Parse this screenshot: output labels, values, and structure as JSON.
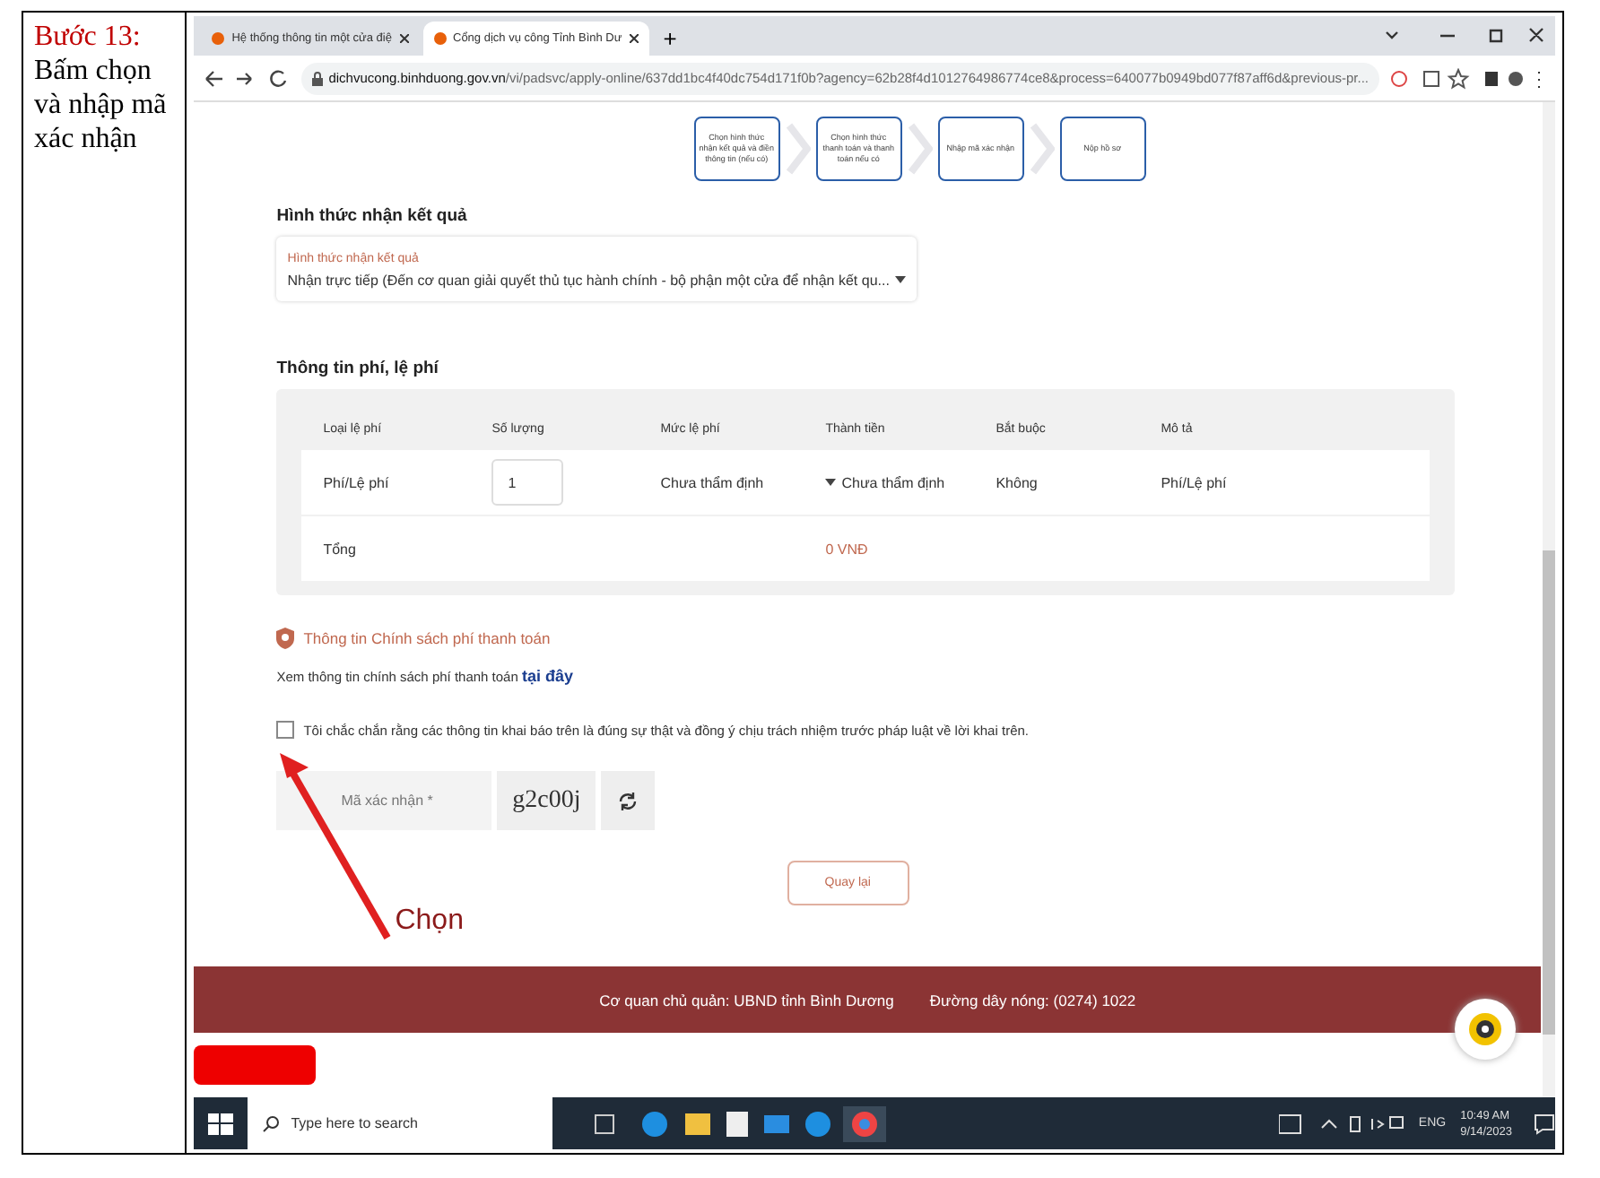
{
  "step": {
    "label": "Bước 13:",
    "text": "Bấm chọn và nhập mã xác nhận"
  },
  "browser": {
    "tabs": [
      {
        "title": "Hệ thống thông tin một cửa điệ",
        "selected": false
      },
      {
        "title": "Cổng dịch vụ công Tỉnh Bình Dư",
        "selected": true
      }
    ],
    "new_tab": "+",
    "url_host": "dichvucong.binhduong.gov.vn",
    "url_path": "/vi/padsvc/apply-online/637dd1bc4f40dc754d171f0b?agency=62b28f4d1012764986774ce8&process=640077b0949bd077f87aff6d&previous-pr..."
  },
  "stepper": [
    {
      "label": "Chọn hình thức nhận kết quả và điền thông tin (nếu có)"
    },
    {
      "label": "Chọn hình thức thanh toán và thanh toán nếu có"
    },
    {
      "label": "Nhập mã xác nhận"
    },
    {
      "label": "Nộp hồ sơ"
    }
  ],
  "result_section": {
    "title": "Hình thức nhận kết quả",
    "field_label": "Hình thức nhận kết quả",
    "field_value": "Nhận trực tiếp (Đến cơ quan giải quyết thủ tục hành chính - bộ phận một cửa để nhận kết qu..."
  },
  "fee_section": {
    "title": "Thông tin phí, lệ phí",
    "columns": [
      "Loại lệ phí",
      "Số lượng",
      "Mức lệ phí",
      "Thành tiền",
      "Bắt buộc",
      "Mô tả"
    ],
    "rows": [
      {
        "type": "Phí/Lệ phí",
        "quantity": "1",
        "rate": "Chưa thẩm định",
        "amount": "Chưa thẩm định",
        "required": "Không",
        "description": "Phí/Lệ phí"
      }
    ],
    "total_label": "Tổng",
    "total_value": "0 VNĐ"
  },
  "policy": {
    "title": "Thông tin Chính sách phí thanh toán",
    "text": "Xem thông tin chính sách phí thanh toán",
    "link": "tại đây"
  },
  "agreement": {
    "checked": false,
    "text": "Tôi chắc chắn rằng các thông tin khai báo trên là đúng sự thật và đồng ý chịu trách nhiệm trước pháp luật về lời khai trên."
  },
  "captcha": {
    "placeholder": "Mã xác nhận *",
    "code": "g2c00j"
  },
  "back_button": "Quay lại",
  "annotation": {
    "text": "Chọn"
  },
  "footer": {
    "agency": "Cơ quan chủ quản: UBND tỉnh Bình Dương",
    "hotline": "Đường dây nóng: (0274) 1022"
  },
  "taskbar": {
    "search_placeholder": "Type here to search",
    "language": "ENG",
    "time": "10:49 AM",
    "date": "9/14/2023"
  }
}
